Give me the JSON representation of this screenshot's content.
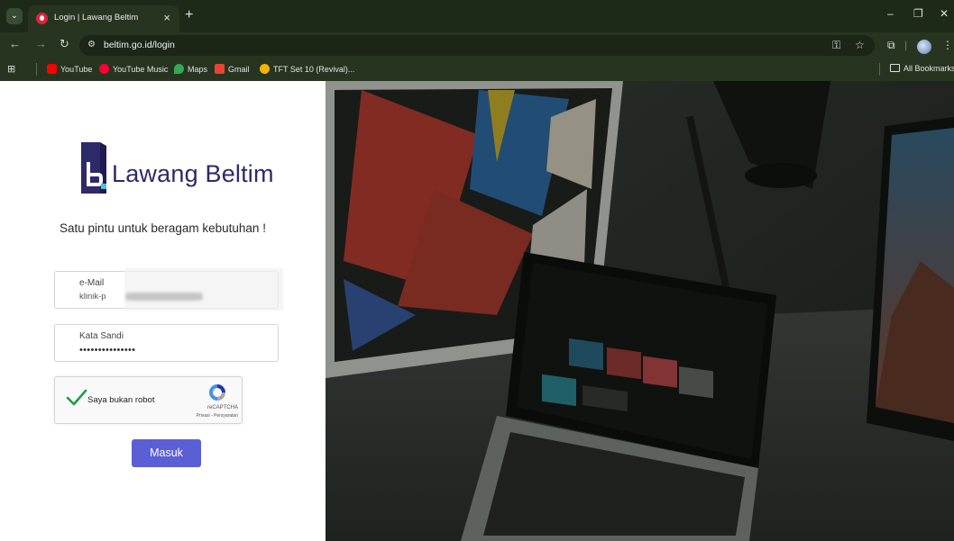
{
  "browser": {
    "tab_title": "Login | Lawang Beltim",
    "url": "beltim.go.id/login",
    "tab_close_glyph": "×",
    "new_tab_glyph": "+",
    "bookmarks": [
      {
        "label": "YouTube",
        "icon": "youtube-icon",
        "color": "#ff0000"
      },
      {
        "label": "YouTube Music",
        "icon": "youtube-music-icon",
        "color": "#ff0033"
      },
      {
        "label": "Maps",
        "icon": "maps-icon",
        "color": "#34a853"
      },
      {
        "label": "Gmail",
        "icon": "gmail-icon",
        "color": "#ea4335"
      },
      {
        "label": "TFT Set 10 (Revival)...",
        "icon": "tft-icon",
        "color": "#f4b400"
      }
    ],
    "all_bookmarks_label": "All Bookmarks"
  },
  "brand": {
    "name": "Lawang Beltim",
    "tagline": "Satu pintu untuk beragam kebutuhan !",
    "primary_color": "#2d2a6a",
    "accent_color": "#5b5fd6"
  },
  "form": {
    "email_label": "e-Mail",
    "email_value": "klinik-p",
    "password_label": "Kata Sandi",
    "password_value": "•••••••••••••••",
    "recaptcha_label": "Saya bukan robot",
    "recaptcha_brand": "reCAPTCHA",
    "recaptcha_links": "Privasi - Persyaratan",
    "submit_label": "Masuk"
  }
}
